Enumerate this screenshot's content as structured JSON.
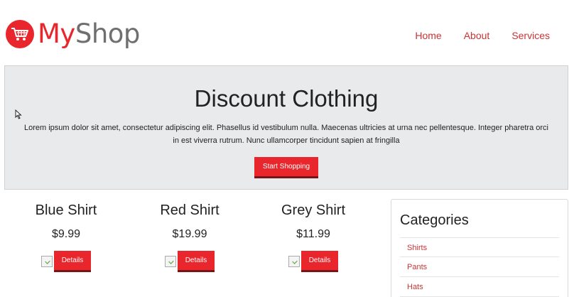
{
  "brand": {
    "my": "My",
    "shop": "Shop",
    "accent_color": "#e8262c"
  },
  "nav": {
    "items": [
      {
        "label": "Home"
      },
      {
        "label": "About"
      },
      {
        "label": "Services"
      }
    ]
  },
  "hero": {
    "title": "Discount Clothing",
    "text": "Lorem ipsum dolor sit amet, consectetur adipiscing elit. Phasellus id vestibulum nulla. Maecenas ultricies at urna nec pellentesque. Integer pharetra orci in est viverra rutrum. Nunc ullamcorper tincidunt sapien at fringilla",
    "button_label": "Start Shopping"
  },
  "products": [
    {
      "name": "Blue Shirt",
      "price": "$9.99",
      "button_label": "Details"
    },
    {
      "name": "Red Shirt",
      "price": "$19.99",
      "button_label": "Details"
    },
    {
      "name": "Grey Shirt",
      "price": "$11.99",
      "button_label": "Details"
    }
  ],
  "sidebar": {
    "title": "Categories",
    "items": [
      {
        "label": "Shirts"
      },
      {
        "label": "Pants"
      },
      {
        "label": "Hats"
      }
    ]
  },
  "icons": {
    "logo": "shopping-cart-icon",
    "cursor": "mouse-pointer-icon",
    "product_image": "broken-image-icon"
  }
}
